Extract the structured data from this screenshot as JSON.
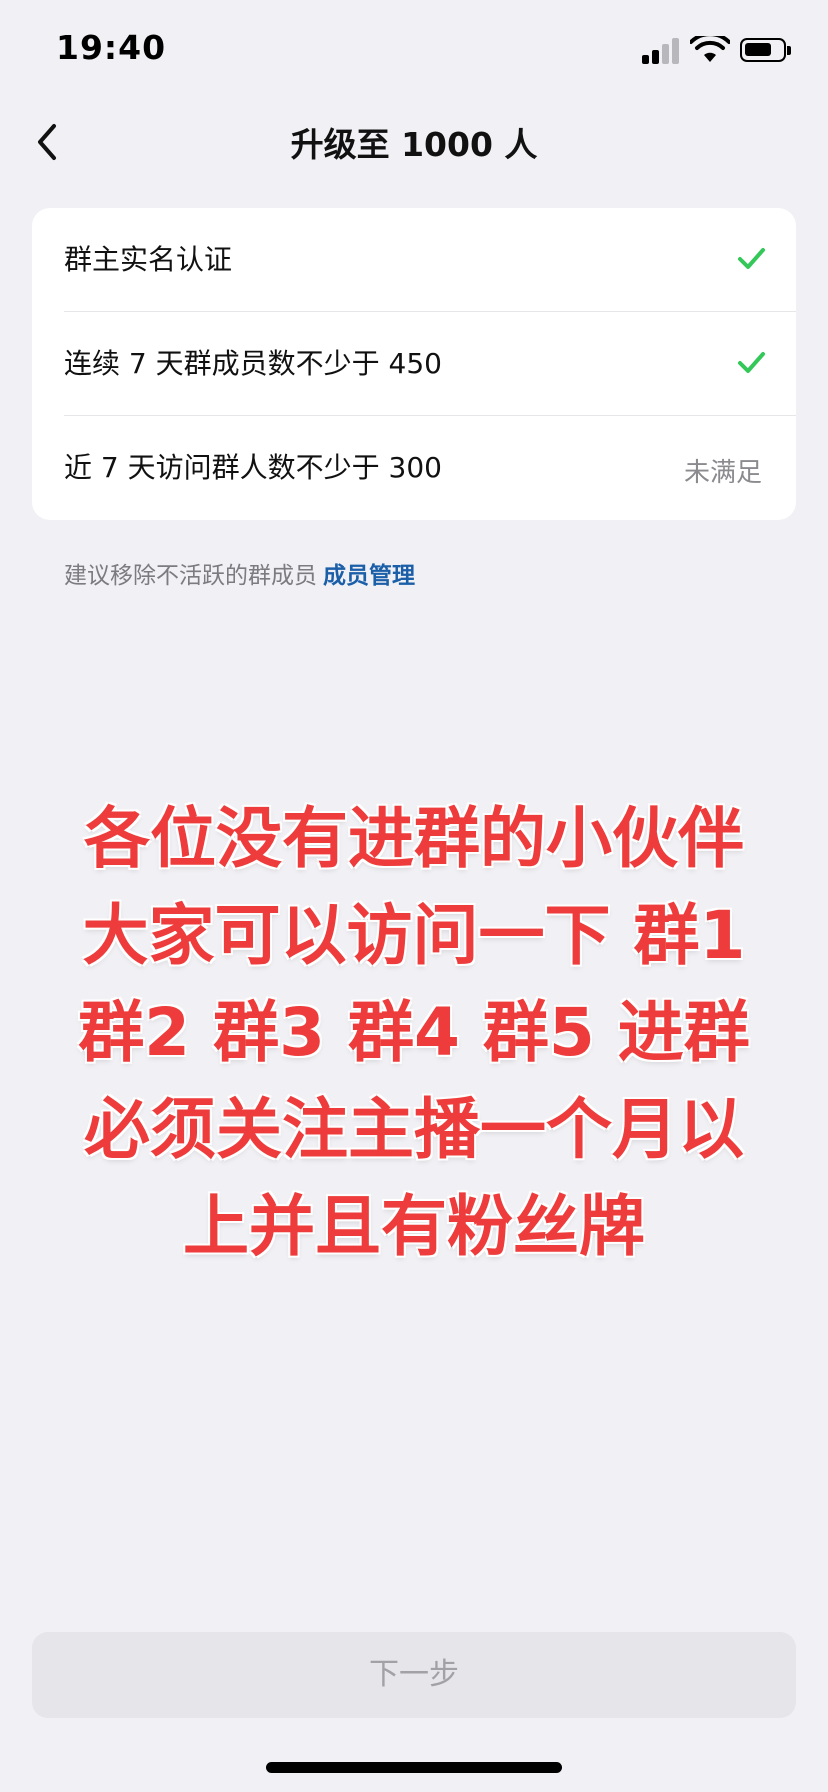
{
  "status_bar": {
    "time": "19:40",
    "signal_bars_filled": 2,
    "signal_bars_total": 4,
    "battery_level": 0.65
  },
  "nav": {
    "title": "升级至 1000 人",
    "back_icon": "chevron-left-icon"
  },
  "requirements": [
    {
      "label": "群主实名认证",
      "met": true,
      "status_icon": "checkmark-icon"
    },
    {
      "label": "连续 7 天群成员数不少于 450",
      "met": true,
      "status_icon": "checkmark-icon"
    },
    {
      "label": "近 7 天访问群人数不少于 300",
      "met": false,
      "status_text": "未满足"
    }
  ],
  "hint": {
    "text": "建议移除不活跃的群成员",
    "link": "成员管理"
  },
  "overlay_text": {
    "lines": [
      "各位没有进群的小伙伴",
      "大家可以访问一下 群1",
      "群2 群3 群4 群5  进群",
      "必须关注主播一个月以",
      "上并且有粉丝牌"
    ]
  },
  "footer": {
    "next_label": "下一步"
  },
  "colors": {
    "background": "#f1f1f5",
    "check_green": "#34c759",
    "link_blue": "#1b5fa8",
    "overlay_red": "#ee3b3b",
    "disabled_button": "#e5e5ea"
  }
}
